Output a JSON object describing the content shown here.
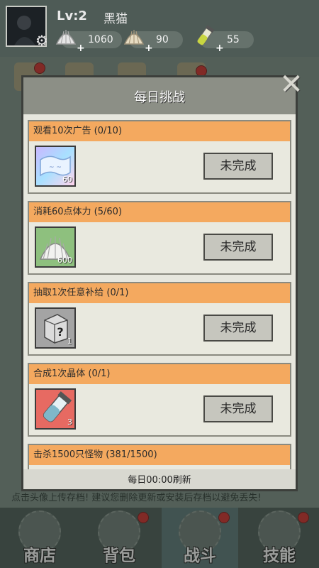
{
  "player": {
    "level": "Lv:2",
    "name": "黑猫"
  },
  "resources": [
    {
      "icon": "shell-icon",
      "value": "1060"
    },
    {
      "icon": "shell-icon",
      "value": "90"
    },
    {
      "icon": "vial-icon",
      "value": "55"
    }
  ],
  "background_hint": "点击头像上传存档! 建议您删除更新或安装后存档以避免丢失!",
  "bottom_nav": {
    "tabs": [
      {
        "label": "商店"
      },
      {
        "label": "背包"
      },
      {
        "label": "战斗",
        "active": true
      },
      {
        "label": "技能"
      }
    ]
  },
  "modal": {
    "title": "每日挑战",
    "tasks": [
      {
        "title": "观看10次广告 (0/10)",
        "reward_icon": "ticket-icon",
        "reward_qty": "60",
        "button": "未完成"
      },
      {
        "title": "消耗60点体力 (5/60)",
        "reward_icon": "shell-icon",
        "reward_qty": "600",
        "button": "未完成"
      },
      {
        "title": "抽取1次任意补给 (0/1)",
        "reward_icon": "mystery-box-icon",
        "reward_qty": "1",
        "button": "未完成"
      },
      {
        "title": "合成1次晶体 (0/1)",
        "reward_icon": "crystal-vial-icon",
        "reward_qty": "3",
        "button": "未完成"
      },
      {
        "title": "击杀1500只怪物 (381/1500)"
      }
    ],
    "footer": "每日00:00刷新"
  }
}
